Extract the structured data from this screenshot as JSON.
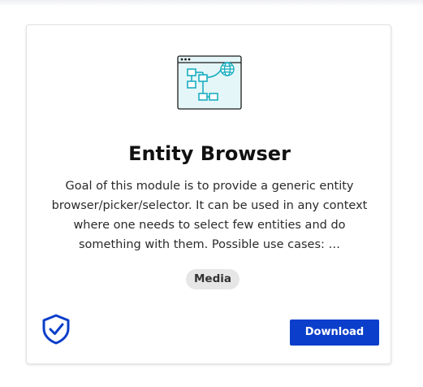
{
  "card": {
    "title": "Entity Browser",
    "description": "Goal of this module is to provide a generic entity browser/picker/selector. It can be used in any context where one needs to select few entities and do something with them. Possible use cases: …",
    "tag": "Media",
    "download_label": "Download",
    "icons": {
      "illustration": "flowchart-globe-window-icon",
      "badge": "shield-check-icon"
    },
    "colors": {
      "accent": "#0b3fcb",
      "illustration_fill": "#e4f6f8",
      "illustration_stroke": "#1aaec1",
      "tag_bg": "#e6e6e6"
    }
  }
}
